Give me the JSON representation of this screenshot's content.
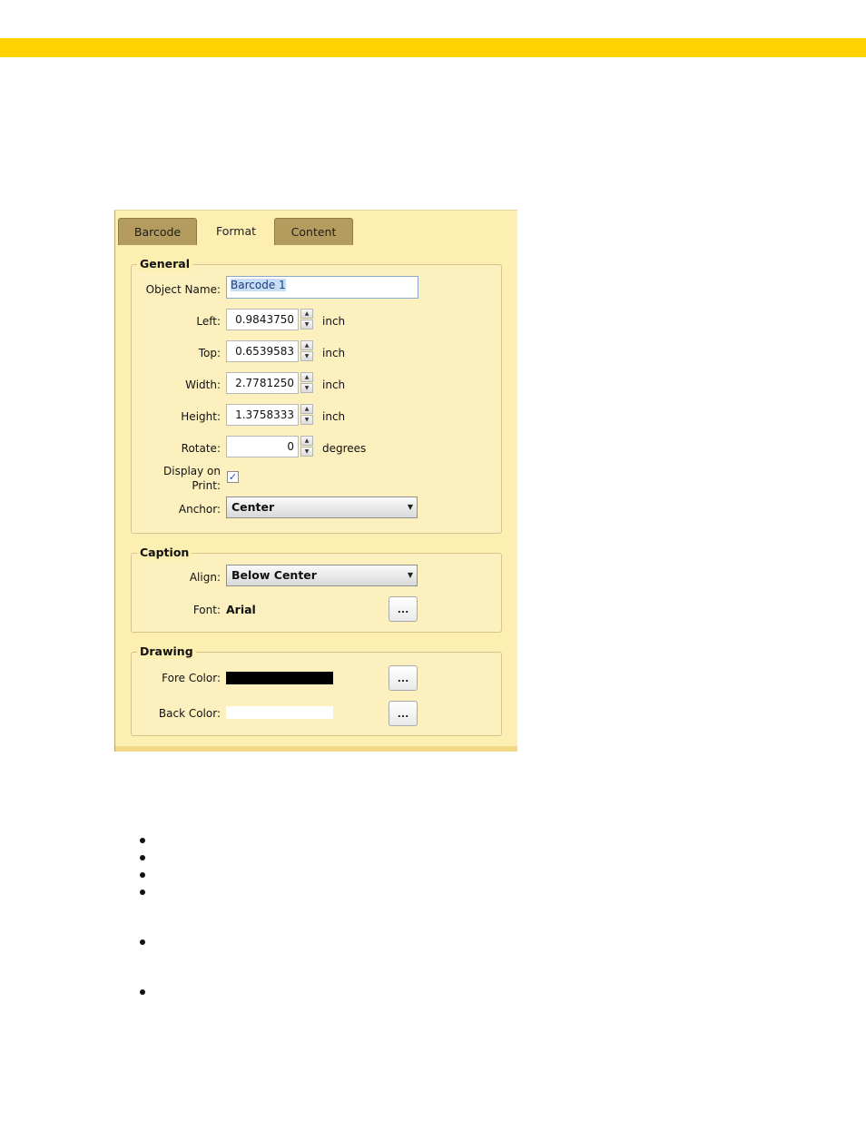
{
  "tabs": [
    {
      "label": "Barcode",
      "active": false
    },
    {
      "label": "Format",
      "active": true
    },
    {
      "label": "Content",
      "active": false
    }
  ],
  "general": {
    "title": "General",
    "object_name_label": "Object Name:",
    "object_name_value": "Barcode 1",
    "left_label": "Left:",
    "left_value": "0.9843750",
    "top_label": "Top:",
    "top_value": "0.6539583",
    "width_label": "Width:",
    "width_value": "2.7781250",
    "height_label": "Height:",
    "height_value": "1.3758333",
    "rotate_label": "Rotate:",
    "rotate_value": "0",
    "unit_inch": "inch",
    "unit_degrees": "degrees",
    "display_on_print_label_1": "Display on",
    "display_on_print_label_2": "Print:",
    "display_on_print_checked": true,
    "anchor_label": "Anchor:",
    "anchor_value": "Center"
  },
  "caption": {
    "title": "Caption",
    "align_label": "Align:",
    "align_value": "Below Center",
    "font_label": "Font:",
    "font_value": "Arial",
    "font_button": "..."
  },
  "drawing": {
    "title": "Drawing",
    "fore_color_label": "Fore Color:",
    "fore_color": "#000000",
    "fore_button": "...",
    "back_color_label": "Back Color:",
    "back_color": "#ffffff",
    "back_button": "..."
  },
  "colors": {
    "accent_bar": "#ffd200",
    "panel_bg": "#fdeeb2"
  },
  "bullet_count": 6
}
